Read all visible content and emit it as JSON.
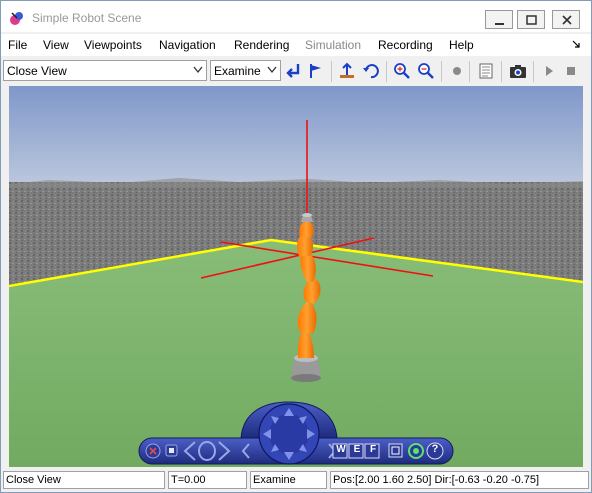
{
  "window": {
    "title": "Simple Robot Scene"
  },
  "menu": {
    "file": "File",
    "view": "View",
    "viewpoints": "Viewpoints",
    "navigation": "Navigation",
    "rendering": "Rendering",
    "simulation": "Simulation",
    "recording": "Recording",
    "help": "Help"
  },
  "toolbar": {
    "viewpoint_select": "Close View",
    "navigation_mode": "Examine"
  },
  "navpanel": {
    "w_label": "W",
    "e_label": "E",
    "f_label": "F",
    "help_label": "?"
  },
  "status": {
    "viewpoint": "Close View",
    "time": "T=0.00",
    "mode": "Examine",
    "position": "Pos:[2.00 1.60 2.50] Dir:[-0.63 -0.20 -0.75]"
  },
  "colors": {
    "sky_top": "#7f97c9",
    "ground": "#7fb56f",
    "floor_border": "#ffff00",
    "robot": "#ff8a00",
    "axes": "#ff0000",
    "navpanel": "#2d3b9a"
  }
}
